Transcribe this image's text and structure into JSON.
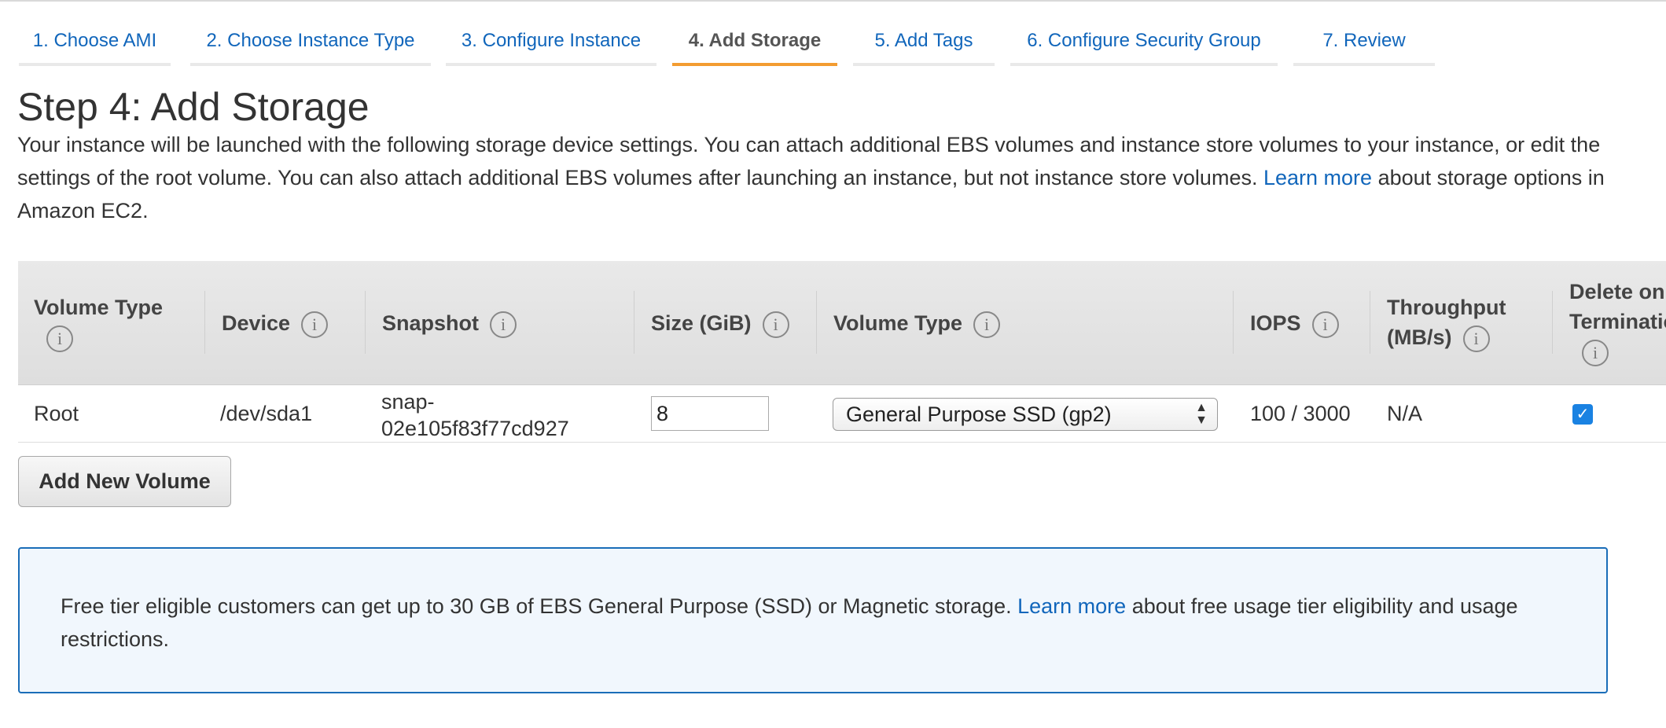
{
  "wizard_tabs": [
    {
      "label": "1. Choose AMI"
    },
    {
      "label": "2. Choose Instance Type"
    },
    {
      "label": "3. Configure Instance"
    },
    {
      "label": "4. Add Storage"
    },
    {
      "label": "5. Add Tags"
    },
    {
      "label": "6. Configure Security Group"
    },
    {
      "label": "7. Review"
    }
  ],
  "active_tab": "4. Add Storage",
  "page": {
    "title": "Step 4: Add Storage",
    "description_part1": "Your instance will be launched with the following storage device settings. You can attach additional EBS volumes and instance store volumes to your instance, or edit the settings of the root volume. You can also attach additional EBS volumes after launching an instance, but not instance store volumes.",
    "learn_more": "Learn more",
    "description_part2": "about storage options in Amazon EC2."
  },
  "table": {
    "headers": {
      "volume_type": "Volume Type",
      "device": "Device",
      "snapshot": "Snapshot",
      "size": "Size (GiB)",
      "volume_type_2": "Volume Type",
      "iops": "IOPS",
      "throughput_line1": "Throughput",
      "throughput_line2": "(MB/s)",
      "delete_line1": "Delete on",
      "delete_line2": "Termination"
    },
    "info_glyph": "i",
    "rows": [
      {
        "volume_type": "Root",
        "device": "/dev/sda1",
        "snapshot_line1": "snap-",
        "snapshot_line2": "02e105f83f77cd927",
        "size": "8",
        "volume_type_select": "General Purpose SSD (gp2)",
        "iops": "100 / 3000",
        "throughput": "N/A",
        "delete_on_termination": true
      }
    ]
  },
  "buttons": {
    "add_new_volume": "Add New Volume"
  },
  "notice": {
    "text_part1": "Free tier eligible customers can get up to 30 GB of EBS General Purpose (SSD) or Magnetic storage.",
    "learn_more": "Learn more",
    "text_part2": "about free usage tier eligibility and usage restrictions."
  },
  "colors": {
    "link": "#1166bb",
    "active_tab_underline": "#f39c31",
    "notice_border": "#1a6db8",
    "notice_background": "#f1f7fd",
    "checkbox": "#1a82e2"
  },
  "icons": {
    "info": "info-circle-icon",
    "select_arrows": "up-down-arrows-icon",
    "checkmark": "checkmark-icon"
  }
}
